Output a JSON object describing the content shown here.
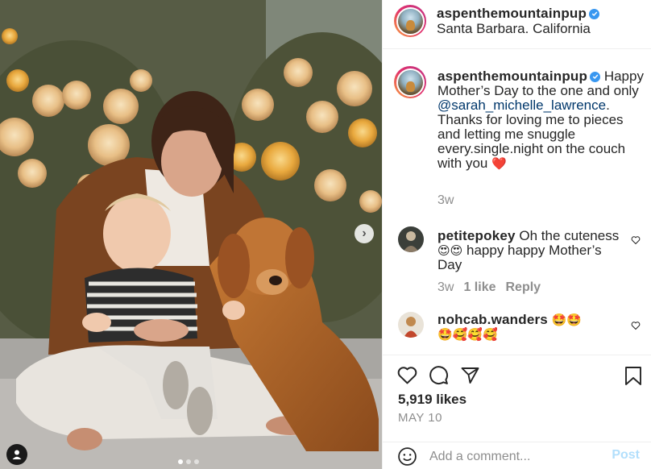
{
  "post": {
    "username": "aspenthemountainpup",
    "location": "Santa Barbara. California",
    "photo_alt": "Woman with baby and golden retriever among roses"
  },
  "caption": {
    "username": "aspenthemountainpup",
    "text_before": "Happy Mother’s Day to the one and only ",
    "mention": "@sarah_michelle_lawrence",
    "text_after": ". Thanks for loving me to pieces and letting me snuggle every.single.night on the couch with you ",
    "emoji": "❤️",
    "time": "3w"
  },
  "comments": [
    {
      "username": "petitepokey",
      "text_a": " Oh the cuteness",
      "emoji_a": "😍😍",
      "text_b": " happy happy Mother’s Day",
      "time": "3w",
      "likes": "1 like",
      "reply": "Reply"
    },
    {
      "username": "nohcab.wanders",
      "emoji_a": " 🤩🤩",
      "emoji_b": "🤩🥰🥰🥰"
    }
  ],
  "stats": {
    "likes": "5,919 likes",
    "date": "MAY 10"
  },
  "comment_box": {
    "placeholder": "Add a comment...",
    "post_label": "Post"
  },
  "colors": {
    "accent": "#3897f0",
    "post_disabled": "#b2dffc",
    "heart": "#ed4956"
  }
}
